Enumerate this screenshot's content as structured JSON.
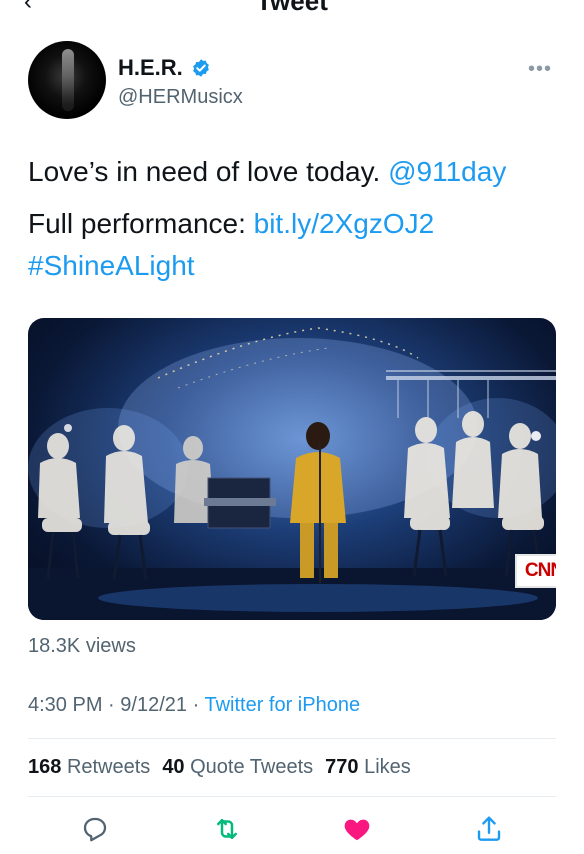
{
  "header": {
    "title": "Tweet",
    "back_icon": "back-arrow-icon"
  },
  "author": {
    "display_name": "H.E.R.",
    "handle": "@HERMusicx",
    "verified": true,
    "verified_color": "#1d9bf0"
  },
  "tweet": {
    "line1_text": "Love’s in need of love today. ",
    "mention": "@911day",
    "line2_text": "Full performance: ",
    "link": "bit.ly/2XgzOJ2",
    "hashtag": "#ShineALight"
  },
  "media": {
    "overlay_logo": "CNN"
  },
  "views": "18.3K views",
  "meta": {
    "time": "4:30 PM",
    "date": "9/12/21",
    "source": "Twitter for iPhone",
    "separator": "·"
  },
  "stats": {
    "retweets_count": "168",
    "retweets_label": "Retweets",
    "quotes_count": "40",
    "quotes_label": "Quote Tweets",
    "likes_count": "770",
    "likes_label": "Likes"
  },
  "actions": [
    {
      "name": "reply",
      "icon": "reply-icon"
    },
    {
      "name": "retweet",
      "icon": "retweet-icon",
      "color": "#00ba7c"
    },
    {
      "name": "like",
      "icon": "heart-icon",
      "color": "#f91880",
      "active": true
    },
    {
      "name": "share",
      "icon": "share-icon",
      "color": "#1d9bf0"
    }
  ],
  "colors": {
    "accent": "#1d9bf0",
    "secondary_text": "#536471",
    "primary_text": "#0f1419"
  }
}
